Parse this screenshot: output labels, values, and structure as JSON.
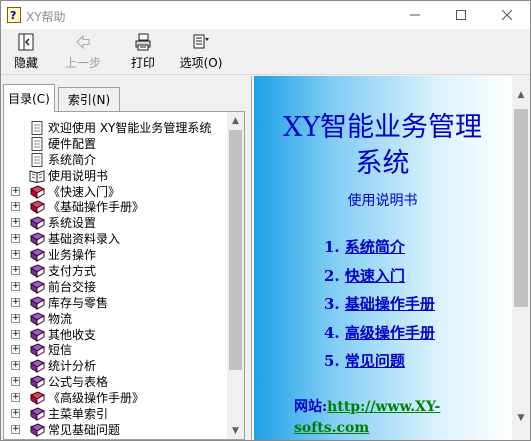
{
  "window": {
    "title": "XY帮助"
  },
  "toolbar": {
    "hide_label": "隐藏",
    "back_label": "上一步",
    "print_label": "打印",
    "options_label": "选项(O)"
  },
  "tabs": [
    {
      "label": "目录(C)",
      "active": true
    },
    {
      "label": "索引(N)",
      "active": false
    }
  ],
  "tree": {
    "children": [
      "欢迎使用 XY智能业务管理系统",
      "硬件配置",
      "系统简介",
      "使用说明书"
    ],
    "items": [
      "《快速入门》",
      "《基础操作手册》",
      "系统设置",
      "基础资料录入",
      "业务操作",
      "支付方式",
      "前台交接",
      "库存与零售",
      "物流",
      "其他收支",
      "短信",
      "统计分析",
      "公式与表格",
      "《高级操作手册》",
      "主菜单索引",
      "常见基础问题"
    ]
  },
  "doc": {
    "title_line1": "XY智能业务管理",
    "title_line2": "系统",
    "subtitle": "使用说明书",
    "links": [
      {
        "num": "1.",
        "label": "系统简介"
      },
      {
        "num": "2.",
        "label": "快速入门"
      },
      {
        "num": "3.",
        "label": "基础操作手册"
      },
      {
        "num": "4.",
        "label": "高级操作手册"
      },
      {
        "num": "5.",
        "label": "常见问题"
      }
    ],
    "site_label": "网站:",
    "site_url": "http://www.XY-softs.com"
  },
  "colors": {
    "doc_text": "#0000cc",
    "link_green": "#008000",
    "book_red": "#c0003c",
    "book_purple": "#7030a0"
  }
}
